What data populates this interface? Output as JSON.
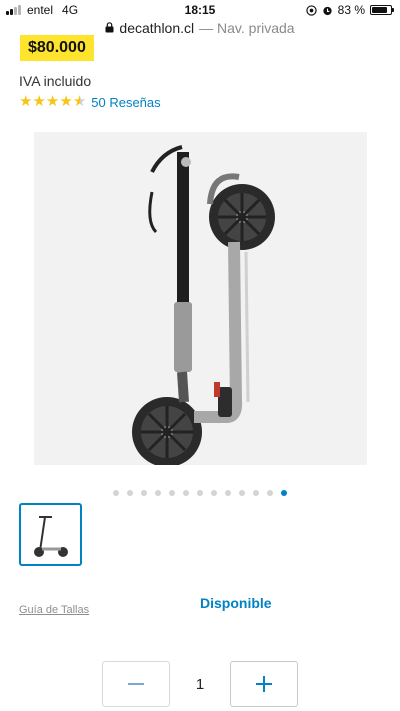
{
  "status_bar": {
    "carrier": "entel",
    "network": "4G",
    "time": "18:15",
    "battery_percent": "83 %",
    "battery_level": 0.83
  },
  "url_bar": {
    "host": "decathlon.cl",
    "mode": "— Nav. privada"
  },
  "product": {
    "price": "$80.000",
    "tax_note": "IVA incluido",
    "rating": 4.5,
    "reviews_label": "50 Reseñas",
    "image_alt": "Scooter",
    "gallery": {
      "dot_count": 13,
      "active_index": 12
    }
  },
  "size_guide_label": "Guía de Tallas",
  "availability_label": "Disponible",
  "quantity": {
    "value": "1"
  },
  "colors": {
    "accent": "#0082c3",
    "price_highlight": "#ffe42d",
    "star": "#f5c518"
  }
}
